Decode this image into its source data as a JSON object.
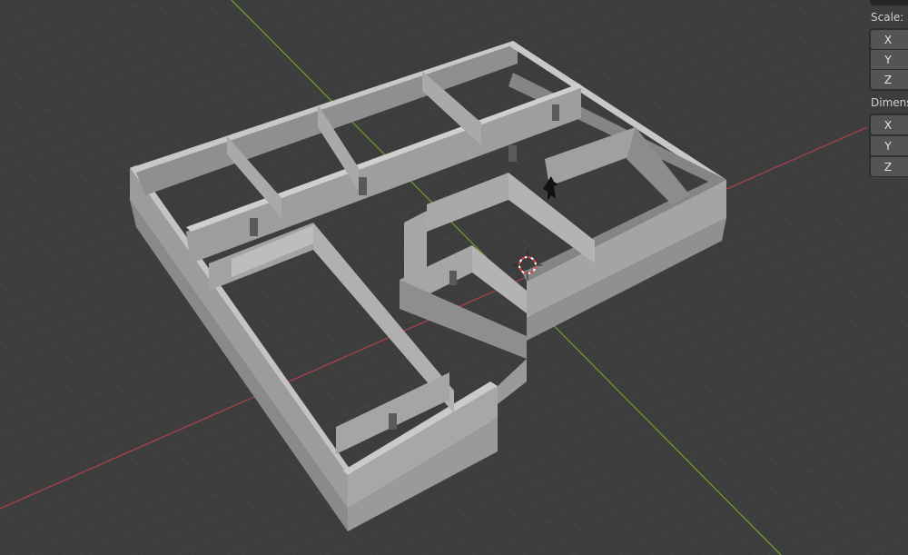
{
  "properties_panel": {
    "scale": {
      "label": "Scale:",
      "axes": [
        "X",
        "Y",
        "Z"
      ]
    },
    "dimensions": {
      "label": "Dimens",
      "axes": [
        "X",
        "Y",
        "Z"
      ]
    }
  },
  "viewport": {
    "grid_color": "#474747",
    "x_axis_color": "#a8404a",
    "y_axis_color": "#6e9a2a",
    "wall_top_color": "#b9b9b9",
    "wall_side_color": "#8e8e8e"
  }
}
